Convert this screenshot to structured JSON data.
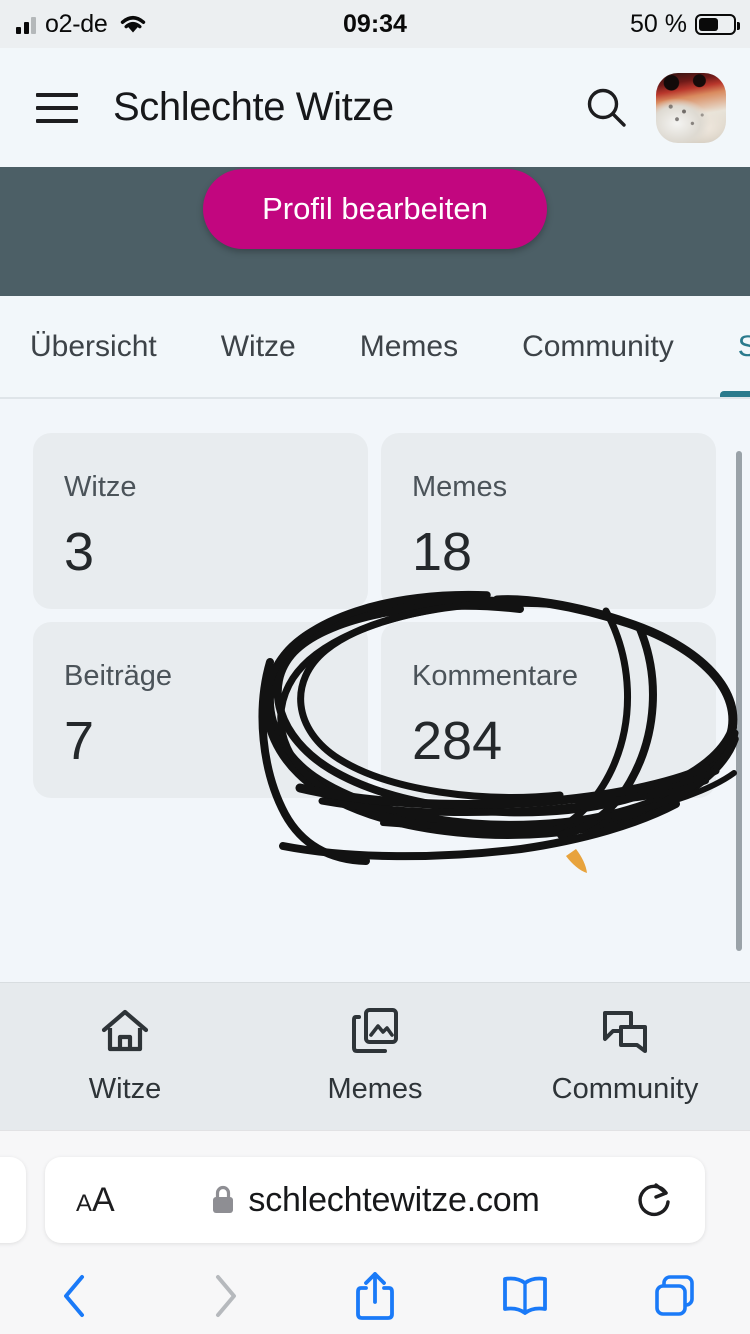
{
  "status_bar": {
    "carrier": "o2-de",
    "time": "09:34",
    "battery_percent": "50 %",
    "battery_level": 50,
    "signal_icon": "cellular-signal-icon",
    "wifi_icon": "wifi-icon",
    "battery_icon": "battery-icon"
  },
  "header": {
    "menu_icon": "hamburger-menu-icon",
    "title": "Schlechte Witze",
    "search_icon": "search-icon",
    "avatar_icon": "user-avatar"
  },
  "banner": {
    "background_color": "#4c5f66",
    "edit_profile_label": "Profil bearbeiten",
    "button_color": "#c2067f"
  },
  "tabs": {
    "active_color": "#2a7a8c",
    "items": [
      {
        "label": "Übersicht",
        "active": false
      },
      {
        "label": "Witze",
        "active": false
      },
      {
        "label": "Memes",
        "active": false
      },
      {
        "label": "Community",
        "active": false
      },
      {
        "label": "S",
        "active": true
      }
    ]
  },
  "stats": {
    "cards": [
      {
        "label": "Witze",
        "value": "3"
      },
      {
        "label": "Memes",
        "value": "18"
      },
      {
        "label": "Beiträge",
        "value": "7"
      },
      {
        "label": "Kommentare",
        "value": "284"
      }
    ]
  },
  "annotation": {
    "type": "handwritten-ink-circle",
    "color": "#121212",
    "accent_color": "#e8a33d",
    "target": "Kommentare"
  },
  "bottom_nav": {
    "items": [
      {
        "label": "Witze",
        "icon": "home-icon"
      },
      {
        "label": "Memes",
        "icon": "photo-library-icon"
      },
      {
        "label": "Community",
        "icon": "chat-bubbles-icon"
      }
    ]
  },
  "browser": {
    "text_size_small": "A",
    "text_size_large": "A",
    "lock_icon": "lock-icon",
    "url": "schlechtewitze.com",
    "reload_icon": "reload-icon",
    "toolbar": [
      {
        "icon": "back-chevron-icon",
        "enabled": true
      },
      {
        "icon": "forward-chevron-icon",
        "enabled": false
      },
      {
        "icon": "share-icon",
        "enabled": true
      },
      {
        "icon": "bookmarks-icon",
        "enabled": true
      },
      {
        "icon": "tabs-icon",
        "enabled": true
      }
    ],
    "accent_color": "#1a7af8"
  }
}
